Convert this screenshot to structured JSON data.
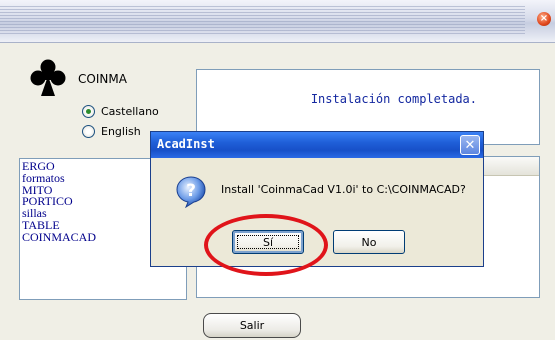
{
  "main_window": {
    "close_symbol": "×"
  },
  "app": {
    "name": "COINMA",
    "logo_icon": "club-suit-icon"
  },
  "language": {
    "options": [
      {
        "label": "Castellano",
        "selected": true
      },
      {
        "label": "English",
        "selected": false
      }
    ]
  },
  "status": {
    "text": "Instalación completada."
  },
  "modules": {
    "items": [
      "ERGO",
      "formatos",
      "MITO",
      "PORTICO",
      "sillas",
      "TABLE",
      "COINMACAD"
    ]
  },
  "exit_button": {
    "label": "Salir"
  },
  "dialog": {
    "title": "AcadInst",
    "close_symbol": "✕",
    "icon": "question-icon",
    "message": "Install 'CoinmaCad V1.0i' to C:\\COINMACAD?",
    "yes_label": "Sí",
    "no_label": "No"
  },
  "colors": {
    "titlebar_blue": "#1f5fd8",
    "highlight_red": "#e0141a",
    "list_text": "#00008b",
    "status_text": "#1428a0"
  }
}
